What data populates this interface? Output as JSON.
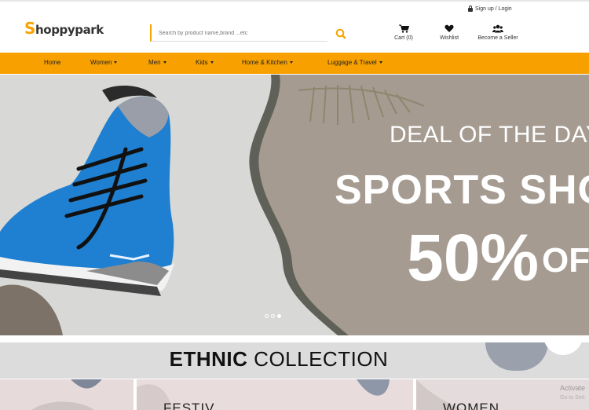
{
  "header": {
    "signin_label": "Sign up / Login",
    "logo_initial": "S",
    "logo_rest": "hoppypark",
    "search_placeholder": "Search by product name,brand ...etc",
    "cart_label": "Cart (0)",
    "wishlist_label": "Wishlist",
    "seller_label": "Become a Seller"
  },
  "nav": {
    "items": [
      {
        "label": "Home",
        "dropdown": false
      },
      {
        "label": "Women",
        "dropdown": true
      },
      {
        "label": "Men",
        "dropdown": true
      },
      {
        "label": "Kids",
        "dropdown": true
      },
      {
        "label": "Home & Kitchen",
        "dropdown": true
      },
      {
        "label": "Luggage & Travel",
        "dropdown": true
      }
    ]
  },
  "hero": {
    "line1": "DEAL OF THE DAY",
    "line2": "SPORTS SHO",
    "line3_pct": "50%",
    "line3_off": "OF",
    "slides": 3,
    "active_slide": 3
  },
  "ethnic": {
    "title_bold": "ETHNIC",
    "title_rest": "COLLECTION"
  },
  "cards": {
    "festive_label": "FESTIV",
    "women_label": "WOMEN"
  },
  "watermark": {
    "line1": "Activate",
    "line2": "Go to Sett"
  },
  "colors": {
    "accent": "#f7a000",
    "hero_bg": "#d7d8d5",
    "hero_panel": "#a59b91"
  }
}
